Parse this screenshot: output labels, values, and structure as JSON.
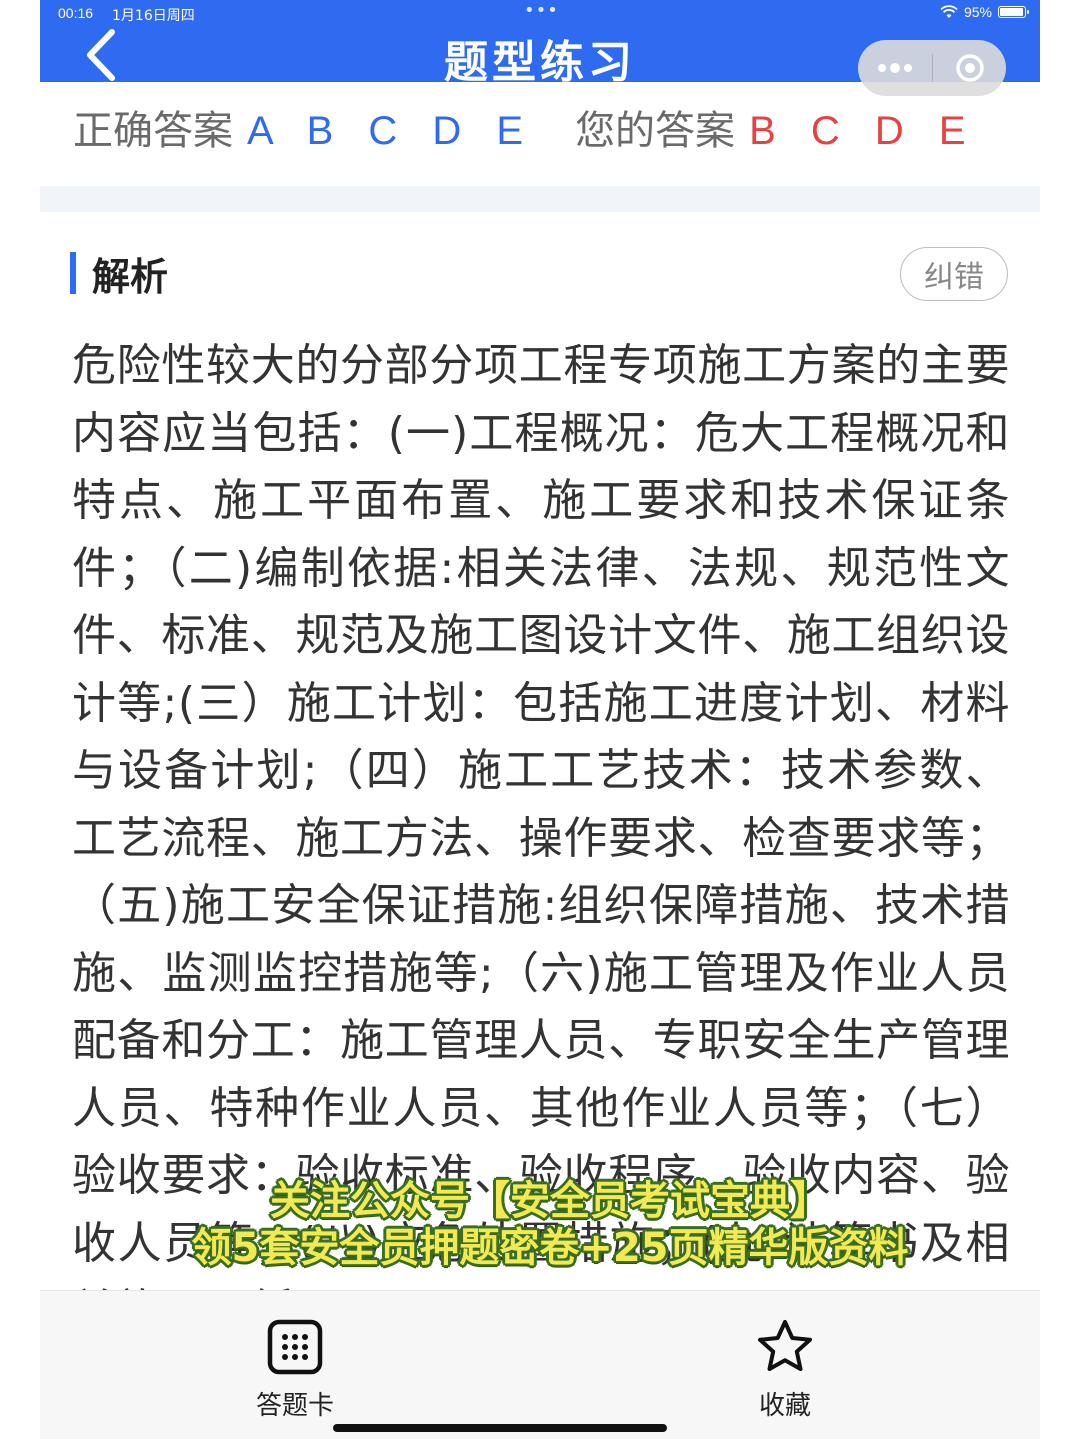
{
  "status": {
    "time": "00:16",
    "date": "1月16日周四",
    "dots": "•••",
    "battery": "95%"
  },
  "header": {
    "title": "题型练习",
    "back_icon": "chevron-left-icon",
    "more_icon": "more-dots-icon",
    "close_icon": "target-close-icon"
  },
  "answer": {
    "correct_label": "正确答案",
    "correct_value": "A B C D E",
    "your_label": "您的答案",
    "your_value": "B C D E"
  },
  "section": {
    "title": "解析",
    "correction_label": "纠错"
  },
  "explanation": "危险性较大的分部分项工程专项施工方案的主要内容应当包括：(一)工程概况：危大工程概况和特点、施工平面布置、施工要求和技术保证条件；（二)编制依据:相关法律、法规、规范性文件、标准、规范及施工图设计文件、施工组织设计等;(三）施工计划：包括施工进度计划、材料与设备计划;（四）施工工艺技术：技术参数、工艺流程、施工方法、操作要求、检查要求等；（五)施工安全保证措施:组织保障措施、技术措施、监测监控措施等;（六)施工管理及作业人员配备和分工：施工管理人员、专职安全生产管理人员、特种作业人员、其他作业人员等；（七）验收要求：验收标准、验收程序、验收内容、验收人员等；(八)应急处置措施；(九)计算书及相关施工图纸。",
  "watermark": {
    "line1": "关注公众号【安全员考试宝典】",
    "line2": "领5套安全员押题密卷+25页精华版资料"
  },
  "tabs": {
    "sheet_label": "答题卡",
    "fav_label": "收藏"
  },
  "colors": {
    "brand": "#2f6bf0",
    "wrong": "#e94040",
    "watermark_fill": "#f2ea55",
    "watermark_stroke": "#3b6e1f"
  }
}
